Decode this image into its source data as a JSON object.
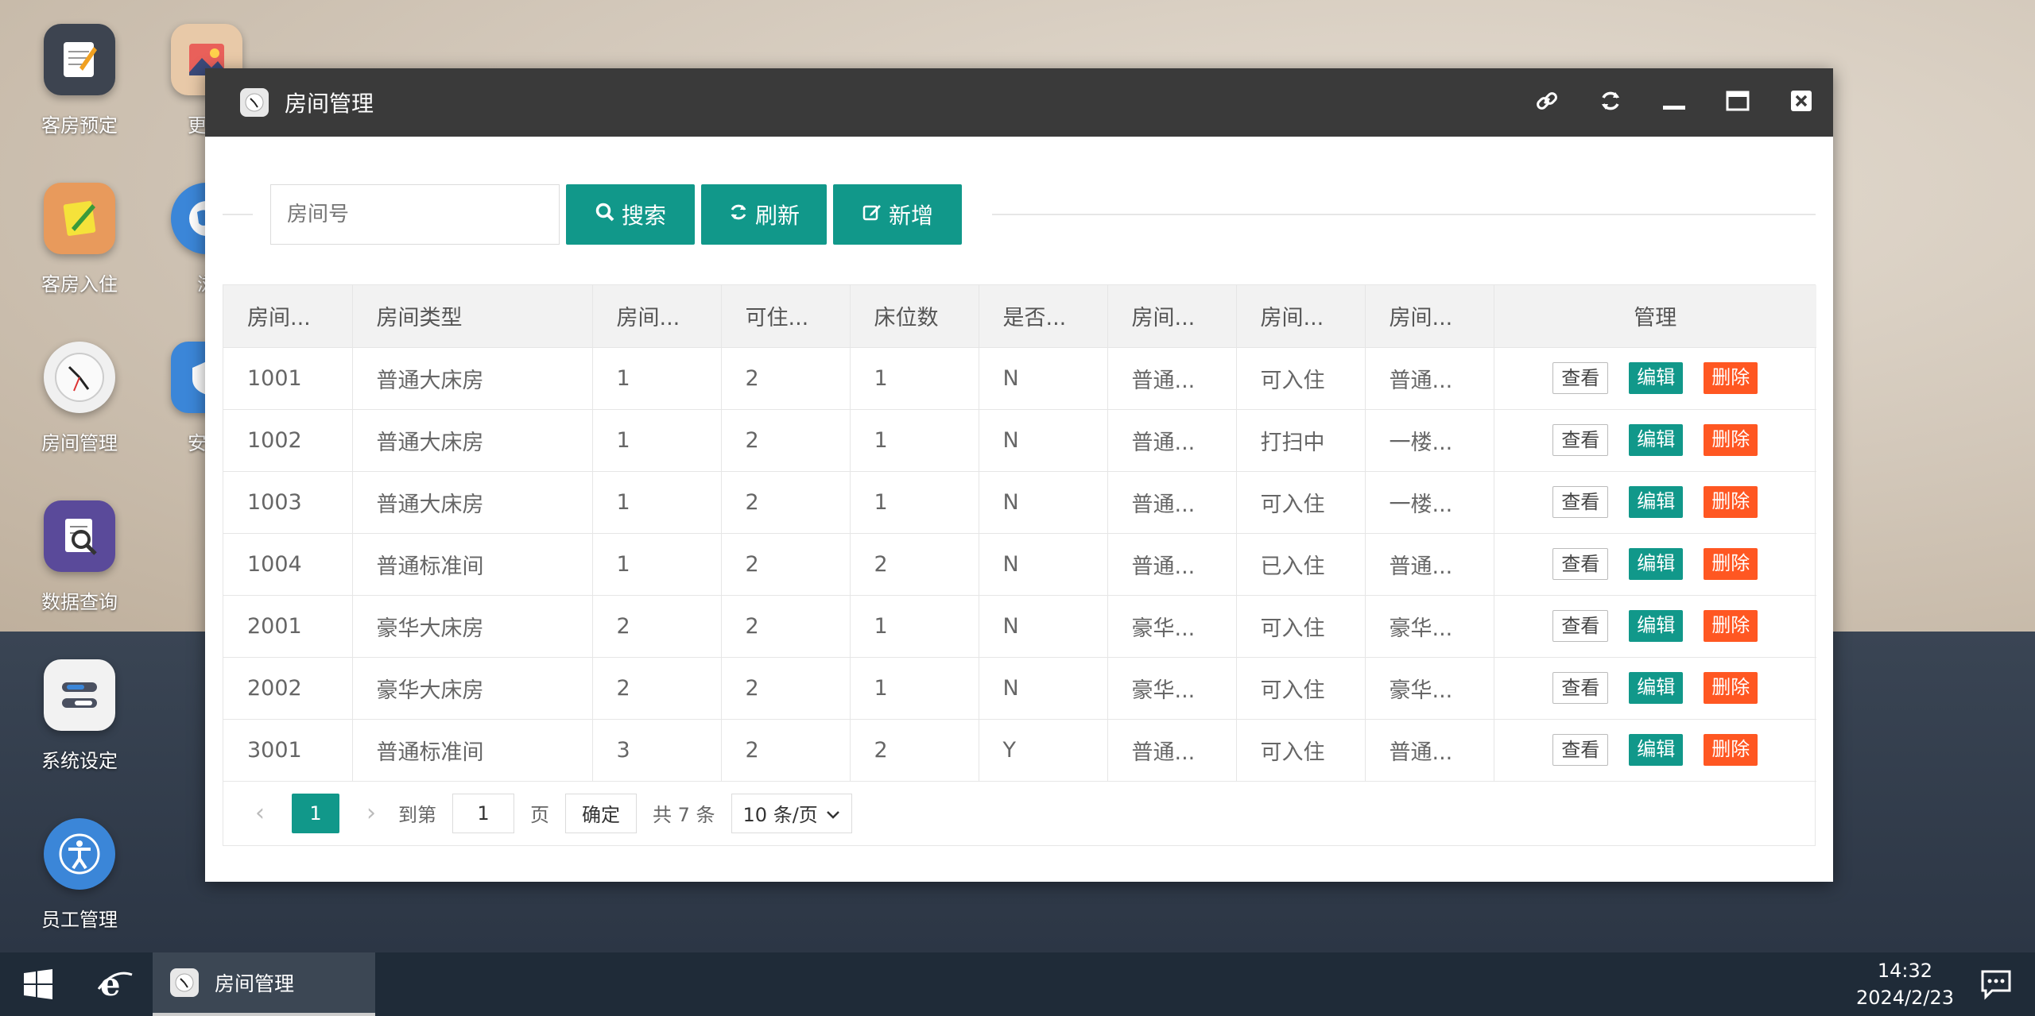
{
  "desktop": {
    "icons": [
      {
        "label": "客房预定"
      },
      {
        "label": "更换"
      },
      {
        "label": "客房入住"
      },
      {
        "label": "浏"
      },
      {
        "label": "房间管理"
      },
      {
        "label": "安全"
      },
      {
        "label": "数据查询"
      },
      {
        "label": "系统设定"
      },
      {
        "label": "员工管理"
      }
    ]
  },
  "window": {
    "title": "房间管理",
    "search": {
      "placeholder": "房间号"
    },
    "buttons": {
      "search": "搜索",
      "refresh": "刷新",
      "add": "新增"
    },
    "table": {
      "headers": [
        "房间...",
        "房间类型",
        "房间...",
        "可住...",
        "床位数",
        "是否...",
        "房间...",
        "房间...",
        "房间...",
        "管理"
      ],
      "rows": [
        [
          "1001",
          "普通大床房",
          "1",
          "2",
          "1",
          "N",
          "普通...",
          "可入住",
          "普通..."
        ],
        [
          "1002",
          "普通大床房",
          "1",
          "2",
          "1",
          "N",
          "普通...",
          "打扫中",
          "一楼..."
        ],
        [
          "1003",
          "普通大床房",
          "1",
          "2",
          "1",
          "N",
          "普通...",
          "可入住",
          "一楼..."
        ],
        [
          "1004",
          "普通标准间",
          "1",
          "2",
          "2",
          "N",
          "普通...",
          "已入住",
          "普通..."
        ],
        [
          "2001",
          "豪华大床房",
          "2",
          "2",
          "1",
          "N",
          "豪华...",
          "可入住",
          "豪华..."
        ],
        [
          "2002",
          "豪华大床房",
          "2",
          "2",
          "1",
          "N",
          "豪华...",
          "可入住",
          "豪华..."
        ],
        [
          "3001",
          "普通标准间",
          "3",
          "2",
          "2",
          "Y",
          "普通...",
          "可入住",
          "普通..."
        ]
      ],
      "actions": {
        "view": "查看",
        "edit": "编辑",
        "delete": "删除"
      }
    },
    "pager": {
      "current": "1",
      "goto_label": "到第",
      "goto_value": "1",
      "page_label": "页",
      "confirm": "确定",
      "total": "共 7 条",
      "page_size": "10 条/页"
    }
  },
  "taskbar": {
    "task_label": "房间管理",
    "time": "14:32",
    "date": "2024/2/23"
  },
  "colors": {
    "accent": "#11988a",
    "danger": "#ff5722"
  }
}
